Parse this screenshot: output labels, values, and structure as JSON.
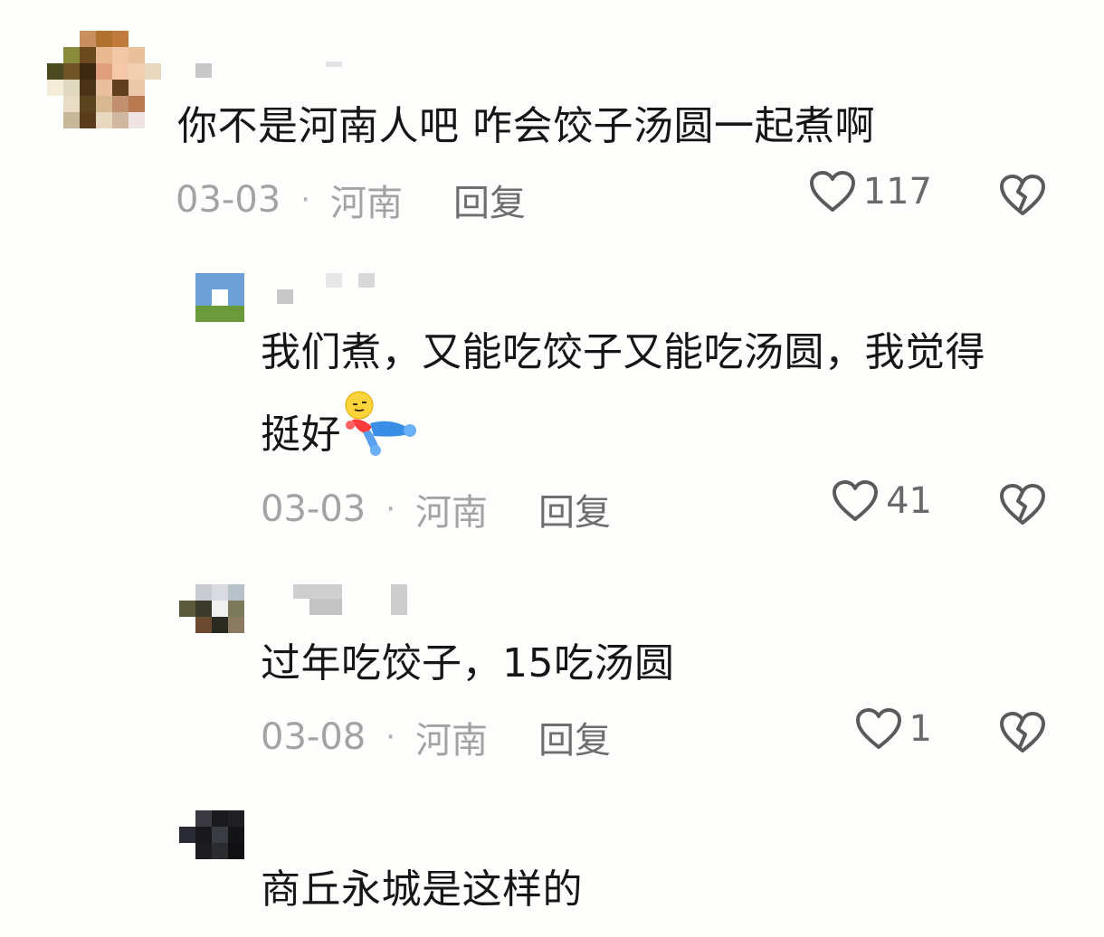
{
  "comments": [
    {
      "text": "你不是河南人吧 咋会饺子汤圆一起煮啊",
      "date": "03-03",
      "location": "河南",
      "reply_label": "回复",
      "likes": "117"
    },
    {
      "text_line1": "我们煮，又能吃饺子又能吃汤圆，我觉得",
      "text_line2": "挺好",
      "date": "03-03",
      "location": "河南",
      "reply_label": "回复",
      "likes": "41"
    },
    {
      "text": "过年吃饺子，15吃汤圆",
      "date": "03-08",
      "location": "河南",
      "reply_label": "回复",
      "likes": "1"
    },
    {
      "text": "商丘永城是这样的"
    }
  ],
  "separator": "·",
  "icons": {
    "like": "heart-outline-icon",
    "dislike": "broken-heart-icon",
    "emoji": "lying-down-emoji-icon"
  }
}
